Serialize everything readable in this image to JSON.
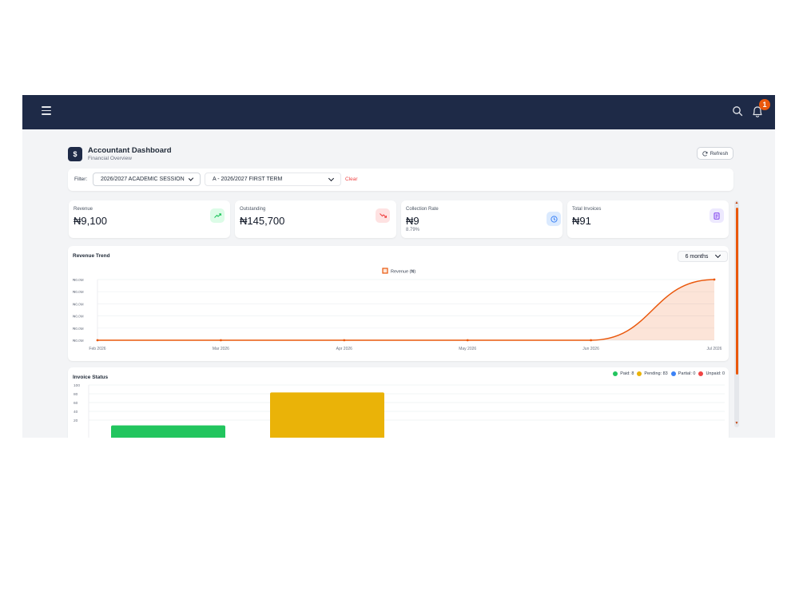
{
  "colors": {
    "navbar": "#1e2a47",
    "accent": "#ea580c",
    "danger": "#ef4444"
  },
  "topbar": {
    "menu_icon": "hamburger-icon",
    "search_icon": "search-icon",
    "bell_icon": "bell-icon",
    "notification_count": "1"
  },
  "header": {
    "icon_symbol": "$",
    "title": "Accountant Dashboard",
    "subtitle": "Financial Overview",
    "refresh_label": "Refresh"
  },
  "filter": {
    "label": "Filter:",
    "session_value": "2026/2027 ACADEMIC SESSION",
    "term_value": "A - 2026/2027 FIRST TERM",
    "clear_label": "Clear"
  },
  "stats": [
    {
      "label": "Revenue",
      "value": "₦9,100",
      "sub": "",
      "icon": "trending-up-icon",
      "icon_color": "#22c55e",
      "icon_bg": "#dcfce7"
    },
    {
      "label": "Outstanding",
      "value": "₦145,700",
      "sub": "",
      "icon": "trending-down-icon",
      "icon_color": "#ef4444",
      "icon_bg": "#fee2e2"
    },
    {
      "label": "Collection Rate",
      "value": "₦9",
      "sub": "8.79%",
      "icon": "clock-icon",
      "icon_color": "#3b82f6",
      "icon_bg": "#dbeafe"
    },
    {
      "label": "Total Invoices",
      "value": "₦91",
      "sub": "",
      "icon": "invoice-icon",
      "icon_color": "#7c3aed",
      "icon_bg": "#ede9fe"
    }
  ],
  "revenue_trend": {
    "title": "Revenue Trend",
    "range_value": "6 months"
  },
  "invoice_status": {
    "title": "Invoice Status"
  },
  "chart_data": [
    {
      "type": "area",
      "title": "Revenue Trend",
      "categories": [
        "Feb 2026",
        "Mar 2026",
        "Apr 2026",
        "May 2026",
        "Jun 2026",
        "Jul 2026"
      ],
      "series": [
        {
          "name": "Revenue (₦)",
          "values": [
            0,
            0,
            0,
            0,
            0,
            9100
          ],
          "color": "#ea580c"
        }
      ],
      "yticks": [
        "₦0.0M",
        "₦0.0M",
        "₦0.0M",
        "₦0.0M",
        "₦0.0M",
        "₦0.0M"
      ],
      "legend_position": "top-center",
      "grid": true
    },
    {
      "type": "bar",
      "title": "Invoice Status",
      "categories": [
        "Paid",
        "Pending",
        "Partial",
        "Unpaid"
      ],
      "values": [
        8,
        83,
        0,
        0
      ],
      "colors": [
        "#22c55e",
        "#eab308",
        "#3b82f6",
        "#ef4444"
      ],
      "legend": [
        "Paid: 8",
        "Pending: 83",
        "Partial: 0",
        "Unpaid: 0"
      ],
      "legend_position": "top-right",
      "yticks": [
        "100",
        "80",
        "60",
        "40",
        "20"
      ],
      "ylim": [
        0,
        100
      ],
      "grid": true
    }
  ]
}
